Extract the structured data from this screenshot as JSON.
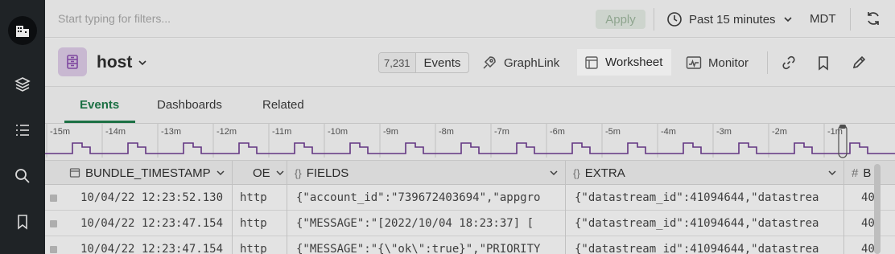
{
  "filter_bar": {
    "placeholder": "Start typing for filters...",
    "apply_label": "Apply",
    "time_range": "Past 15 minutes",
    "timezone": "MDT"
  },
  "header": {
    "dataset_name": "host",
    "event_count": "7,231",
    "events_label": "Events",
    "graphlink_label": "GraphLink",
    "worksheet_label": "Worksheet",
    "monitor_label": "Monitor"
  },
  "tabs": [
    {
      "label": "Events"
    },
    {
      "label": "Dashboards"
    },
    {
      "label": "Related"
    }
  ],
  "timeline": {
    "ticks": [
      "-15m",
      "-14m",
      "-13m",
      "-12m",
      "-11m",
      "-10m",
      "-9m",
      "-8m",
      "-7m",
      "-6m",
      "-5m",
      "-4m",
      "-3m",
      "-2m",
      "-1m"
    ],
    "line_color": "#6b3a8e",
    "accent": "#1f7a4a"
  },
  "table": {
    "columns": [
      "BUNDLE_TIMESTAMP",
      "OE",
      "FIELDS",
      "EXTRA",
      "B"
    ],
    "rows": [
      {
        "timestamp": "10/04/22 12:23:52.130",
        "oe": "http",
        "fields": "{\"account_id\":\"739672403694\",\"appgro",
        "extra": "{\"datastream_id\":41094644,\"datastrea",
        "b": "40"
      },
      {
        "timestamp": "10/04/22 12:23:47.154",
        "oe": "http",
        "fields": "{\"MESSAGE\":\"[2022/10/04 18:23:37] [ ",
        "extra": "{\"datastream_id\":41094644,\"datastrea",
        "b": "40"
      },
      {
        "timestamp": "10/04/22 12:23:47.154",
        "oe": "http",
        "fields": "{\"MESSAGE\":\"{\\\"ok\\\":true}\",\"PRIORITY",
        "extra": "{\"datastream_id\":41094644,\"datastrea",
        "b": "40"
      }
    ]
  },
  "icons": {
    "rail": [
      "building-icon",
      "layers-icon",
      "list-icon",
      "search-icon",
      "bookmark-icon"
    ],
    "header": [
      "link-icon",
      "bookmark-icon",
      "pencil-icon"
    ]
  }
}
